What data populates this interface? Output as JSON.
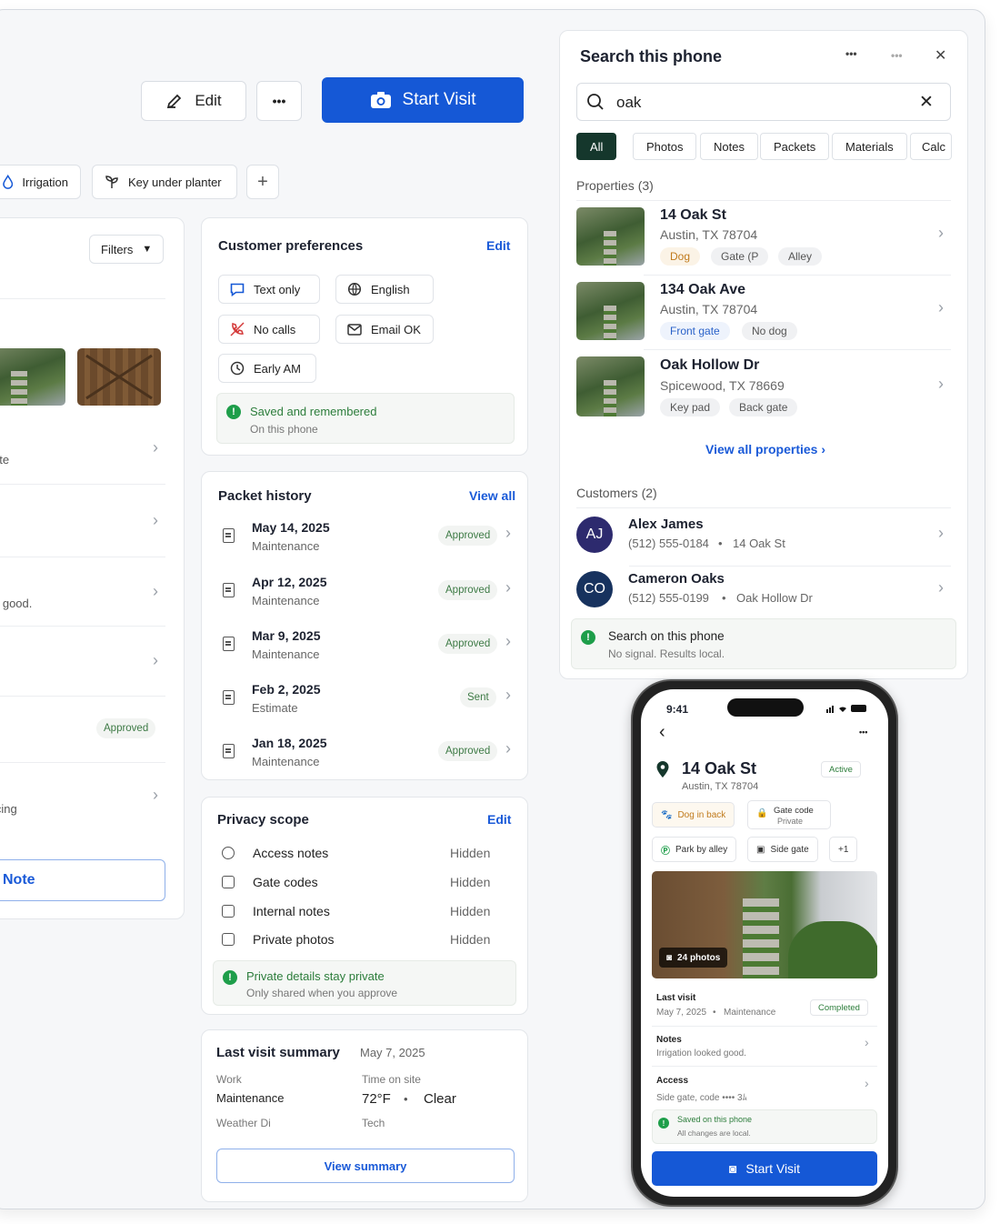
{
  "toolbar": {
    "edit_label": "Edit",
    "more_label": "•••",
    "start_visit_label": "Start Visit"
  },
  "tags": {
    "irrigation": "Irrigation",
    "key": "Key under planter",
    "add": "+"
  },
  "left": {
    "filters_label": "Filters",
    "row_texts": [
      "ete",
      "d good.",
      "icing"
    ],
    "approved_badge": "Approved",
    "note_button": "Note"
  },
  "preferences": {
    "title": "Customer preferences",
    "edit_label": "Edit",
    "items": [
      "Text only",
      "English",
      "No calls",
      "Email OK",
      "Early AM"
    ],
    "note_title": "Saved and remembered",
    "note_sub": "On this phone"
  },
  "packets": {
    "title": "Packet history",
    "view_all": "View all",
    "rows": [
      {
        "date": "May 14, 2025",
        "type": "Maintenance",
        "status": "Approved"
      },
      {
        "date": "Apr 12, 2025",
        "type": "Maintenance",
        "status": "Approved"
      },
      {
        "date": "Mar 9, 2025",
        "type": "Maintenance",
        "status": "Approved"
      },
      {
        "date": "Feb 2, 2025",
        "type": "Estimate",
        "status": "Sent"
      },
      {
        "date": "Jan 18, 2025",
        "type": "Maintenance",
        "status": "Approved"
      }
    ]
  },
  "privacy": {
    "title": "Privacy scope",
    "edit_label": "Edit",
    "rows": [
      {
        "label": "Access notes",
        "value": "Hidden"
      },
      {
        "label": "Gate codes",
        "value": "Hidden"
      },
      {
        "label": "Internal notes",
        "value": "Hidden"
      },
      {
        "label": "Private photos",
        "value": "Hidden"
      }
    ],
    "note_title": "Private details stay private",
    "note_sub": "Only shared when you approve"
  },
  "last_visit": {
    "title": "Last visit summary",
    "date": "May 7, 2025",
    "work_label": "Work",
    "work_value": "Maintenance",
    "time_label": "Time on site",
    "temp": "72°F",
    "sep": "•",
    "weather": "Clear",
    "weather_label": "Weather Di",
    "tech_label": "Tech",
    "button": "View summary"
  },
  "search": {
    "title": "Search this phone",
    "more1": "•••",
    "more2": "•••",
    "close": "✕",
    "query": "oak",
    "clear": "✕",
    "tabs": [
      "All",
      "Photos",
      "Notes",
      "Packets",
      "Materials",
      "Calc"
    ],
    "properties_heading": "Properties (3)",
    "properties": [
      {
        "name": "14 Oak St",
        "address": "Austin, TX 78704",
        "tags": [
          "Dog",
          "Gate (P",
          "Alley"
        ]
      },
      {
        "name": "134 Oak Ave",
        "address": "Austin, TX 78704",
        "tags": [
          "Front gate",
          "No dog"
        ]
      },
      {
        "name": "Oak Hollow Dr",
        "address": "Spicewood, TX 78669",
        "tags": [
          "Key pad",
          "Back gate"
        ]
      }
    ],
    "view_all_properties": "View all properties ›",
    "customers_heading": "Customers (2)",
    "customers": [
      {
        "initials": "AJ",
        "name": "Alex James",
        "phone": "(512) 555-0184",
        "sep": "•",
        "address": "14 Oak St"
      },
      {
        "initials": "CO",
        "name": "Cameron Oaks",
        "phone": "(512) 555-0199",
        "sep": "•",
        "address": "Oak Hollow Dr"
      }
    ],
    "note_title": "Search on this phone",
    "note_sub": "No signal. Results local."
  },
  "phone": {
    "time": "9:41",
    "back": "‹",
    "more": "•••",
    "title": "14 Oak St",
    "status": "Active",
    "address": "Austin, TX 78704",
    "chips": {
      "dog": "Dog in back",
      "gate_title": "Gate code",
      "gate_sub": "Private",
      "park": "Park by alley",
      "side": "Side gate",
      "more": "+1"
    },
    "photos": "24 photos",
    "last_visit_label": "Last visit",
    "last_visit_date": "May 7, 2025",
    "sep": "•",
    "last_visit_type": "Maintenance",
    "last_visit_status": "Completed",
    "notes_label": "Notes",
    "notes_text": "Irrigation looked good.",
    "access_label": "Access",
    "access_text": "Side gate, code •••• 3ﾑ",
    "saved_title": "Saved on this phone",
    "saved_sub": "All changes are local.",
    "start_visit": "Start Visit"
  },
  "colors": {
    "primary": "#1558d6",
    "success": "#1e9e4a",
    "avatar_aj": "#2d2a6e",
    "avatar_co": "#17325e"
  }
}
